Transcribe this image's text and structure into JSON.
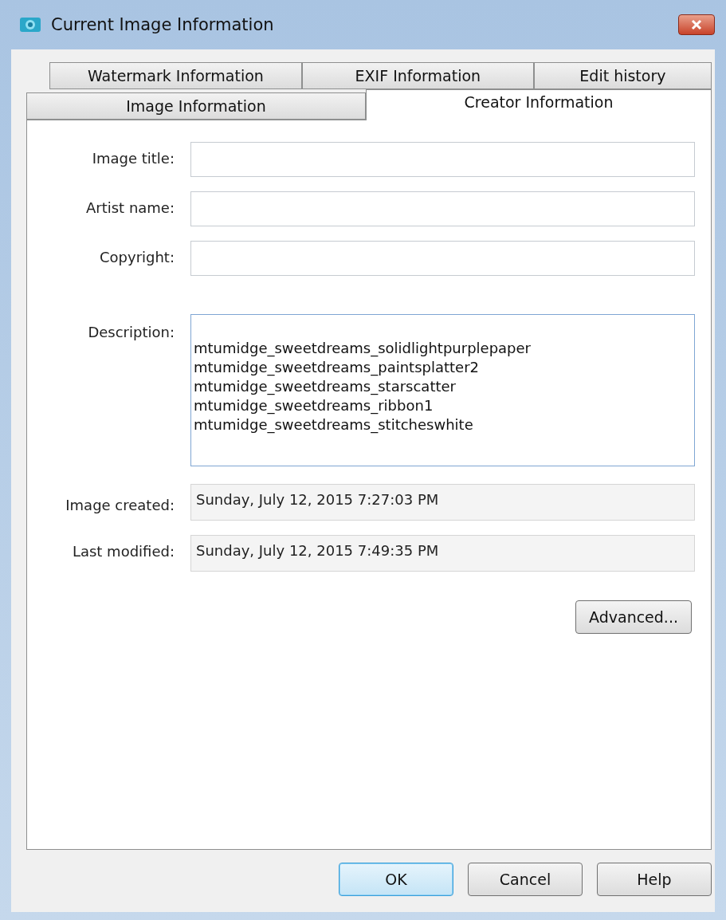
{
  "window": {
    "title": "Current Image Information"
  },
  "tab_rows": [
    [
      {
        "label": "Watermark Information",
        "selected": false
      },
      {
        "label": "EXIF Information",
        "selected": false
      },
      {
        "label": "Edit history",
        "selected": false
      }
    ],
    [
      {
        "label": "Image Information",
        "selected": false
      },
      {
        "label": "Creator Information",
        "selected": true
      }
    ]
  ],
  "fields": [
    {
      "kind": "text",
      "label": "Image title:"
    },
    {
      "kind": "text",
      "label": "Artist name:"
    },
    {
      "kind": "text",
      "label": "Copyright:"
    },
    {
      "kind": "multiline",
      "label": "Description:",
      "lines": [
        "mtumidge_sweetdreams_solidlightpurplepaper",
        "mtumidge_sweetdreams_paintsplatter2",
        "mtumidge_sweetdreams_starscatter",
        "mtumidge_sweetdreams_ribbon1",
        "mtumidge_sweetdreams_stitcheswhite"
      ]
    },
    {
      "kind": "readonly",
      "label": "Image created:",
      "value": "Sunday, July 12, 2015 7:27:03 PM"
    },
    {
      "kind": "readonly",
      "label": "Last modified:",
      "value": "Sunday, July 12, 2015 7:49:35 PM"
    }
  ],
  "advanced_button": "Advanced...",
  "buttons": [
    {
      "label": "OK",
      "default": true
    },
    {
      "label": "Cancel",
      "default": false
    },
    {
      "label": "Help",
      "default": false
    }
  ]
}
